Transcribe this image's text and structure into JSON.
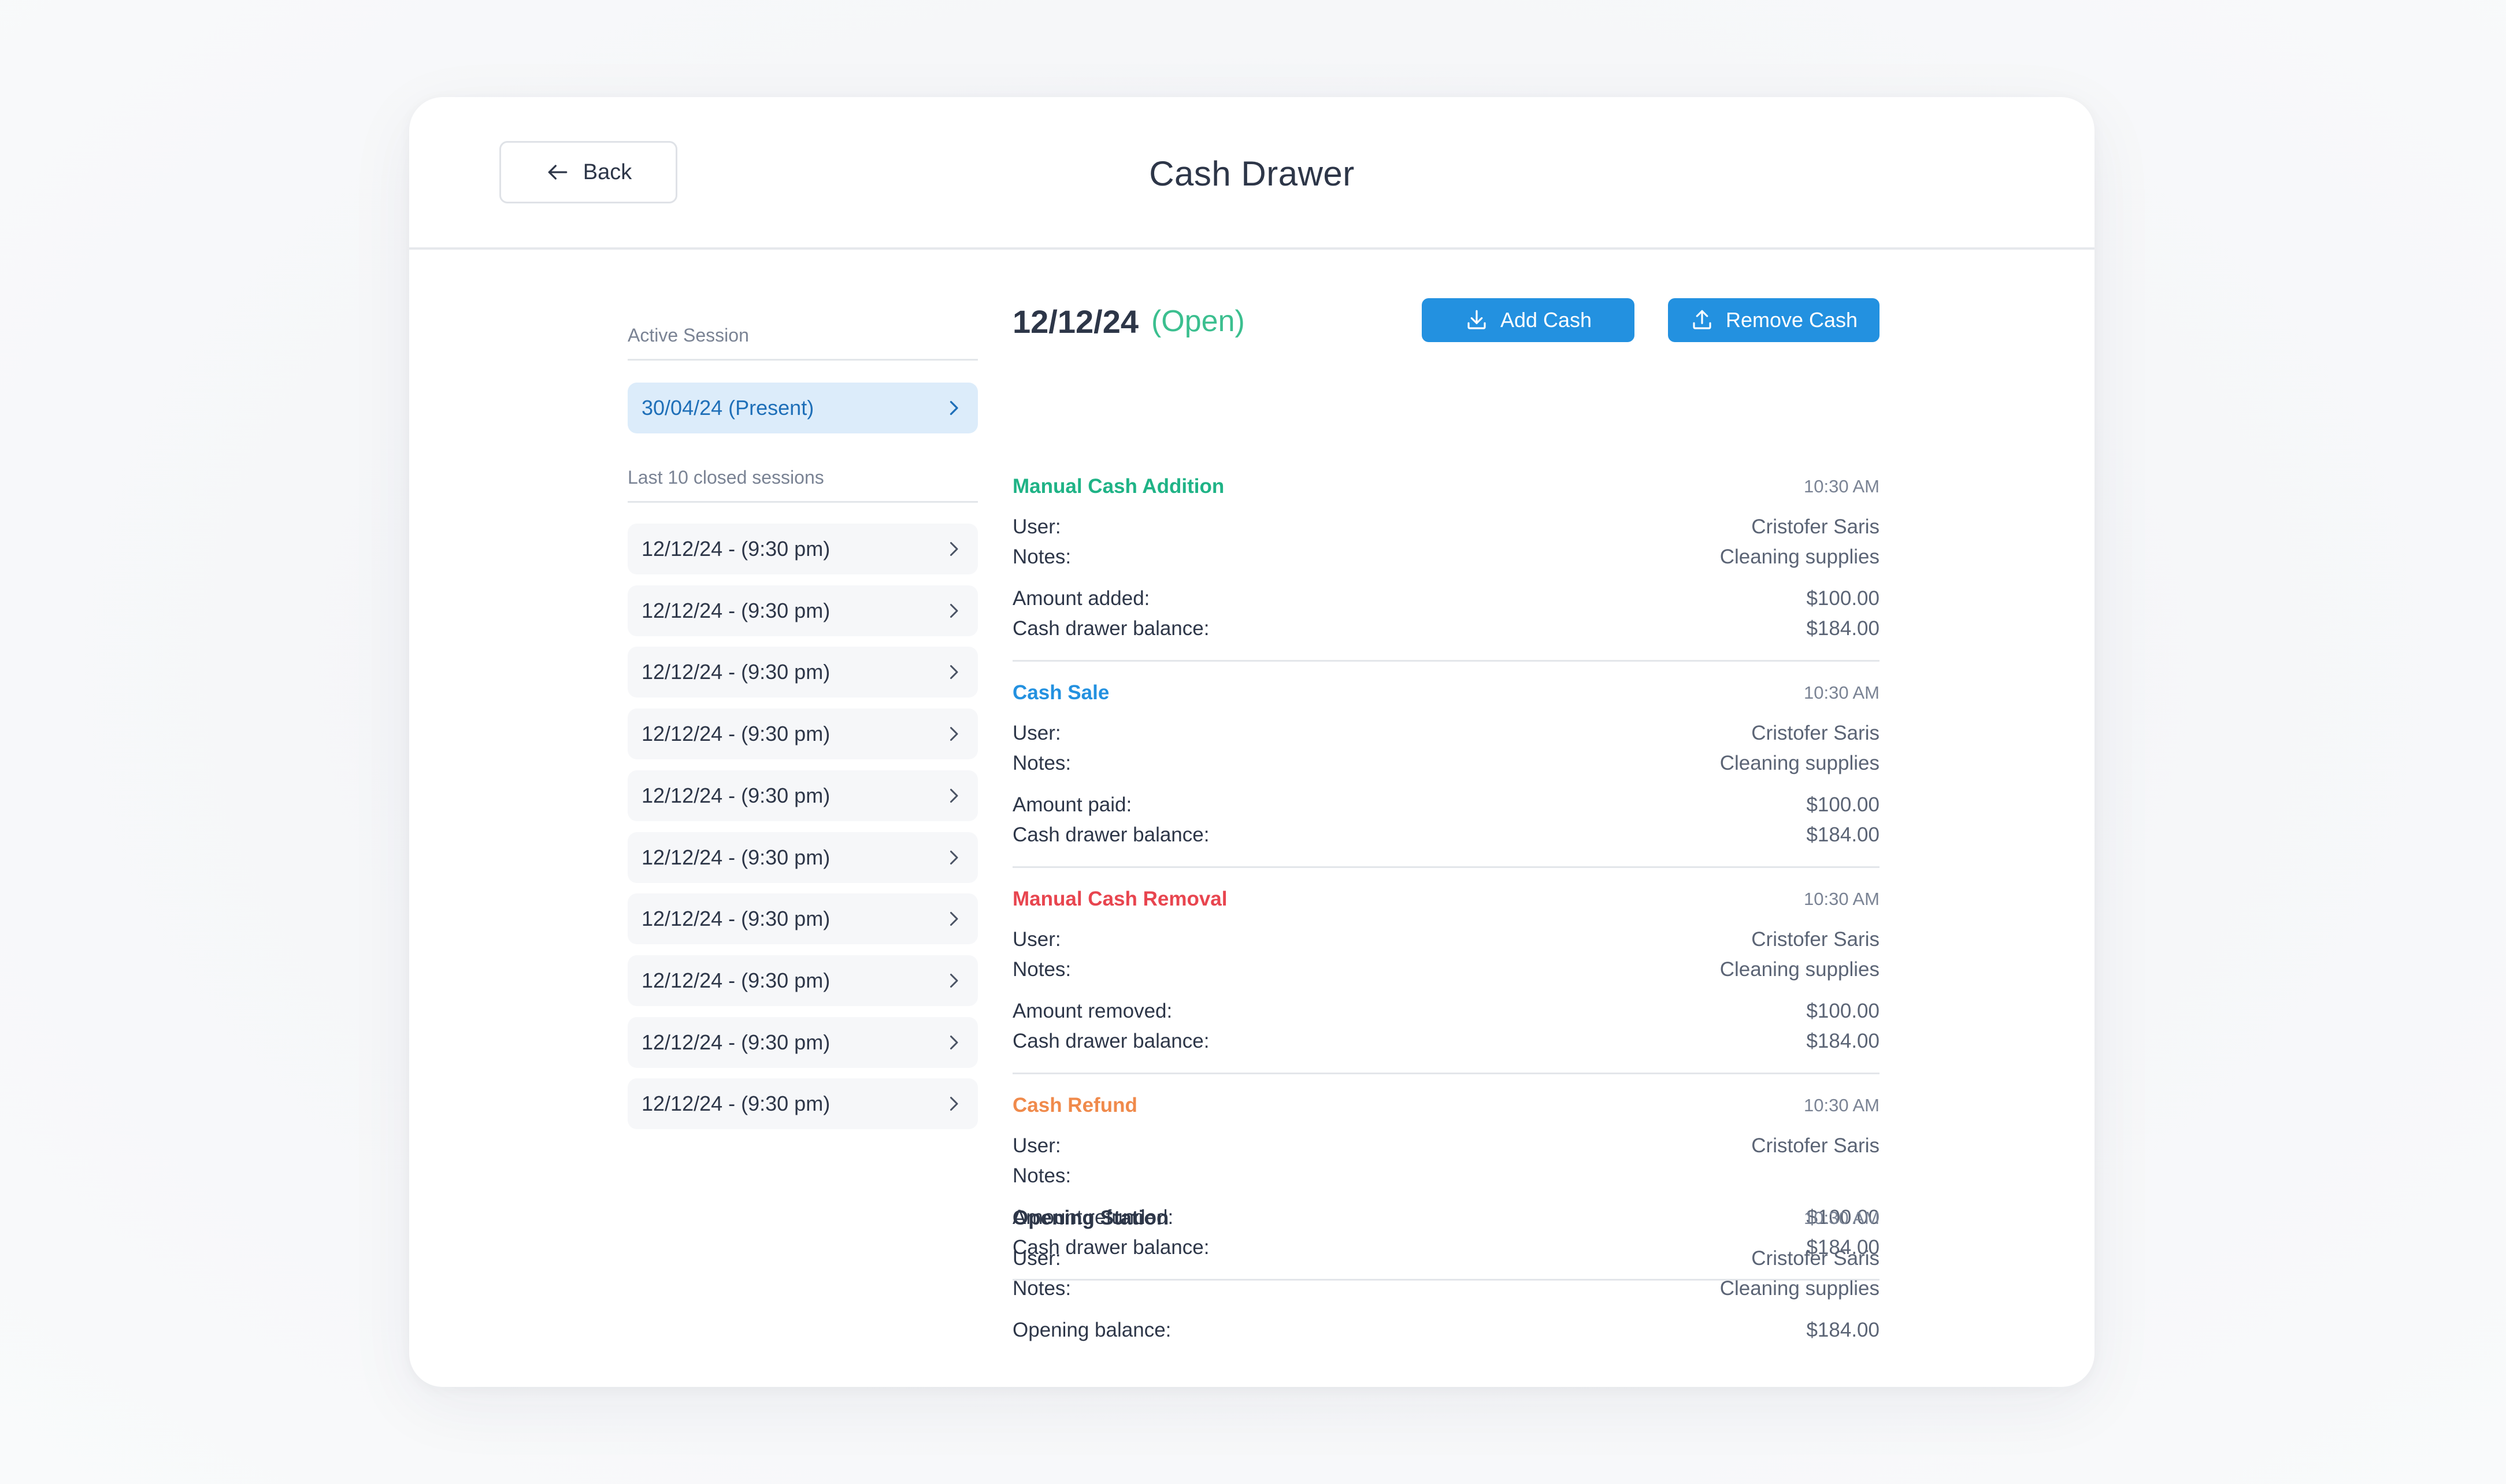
{
  "header": {
    "back_label": "Back",
    "title": "Cash Drawer"
  },
  "sidebar": {
    "active_label": "Active Session",
    "active_session": "30/04/24 (Present)",
    "closed_label": "Last 10 closed sessions",
    "closed_sessions": [
      "12/12/24 - (9:30 pm)",
      "12/12/24 - (9:30 pm)",
      "12/12/24 - (9:30 pm)",
      "12/12/24 - (9:30 pm)",
      "12/12/24 - (9:30 pm)",
      "12/12/24 - (9:30 pm)",
      "12/12/24 - (9:30 pm)",
      "12/12/24 - (9:30 pm)",
      "12/12/24 - (9:30 pm)",
      "12/12/24 - (9:30 pm)"
    ]
  },
  "main": {
    "session_date": "12/12/24",
    "session_status": "(Open)",
    "add_cash_label": "Add Cash",
    "remove_cash_label": "Remove Cash",
    "entries": [
      {
        "title": "Manual Cash Addition",
        "title_color": "#1fb386",
        "time": "10:30 AM",
        "user_label": "User:",
        "user": "Cristofer Saris",
        "notes_label": "Notes:",
        "notes": "Cleaning supplies",
        "amount_label": "Amount added:",
        "amount": "$100.00",
        "balance_label": "Cash drawer balance:",
        "balance": "$184.00"
      },
      {
        "title": "Cash Sale",
        "title_color": "#2391e0",
        "time": "10:30 AM",
        "user_label": "User:",
        "user": "Cristofer Saris",
        "notes_label": "Notes:",
        "notes": "Cleaning supplies",
        "amount_label": "Amount paid:",
        "amount": "$100.00",
        "balance_label": "Cash drawer balance:",
        "balance": "$184.00"
      },
      {
        "title": "Manual Cash Removal",
        "title_color": "#e8454f",
        "time": "10:30 AM",
        "user_label": "User:",
        "user": "Cristofer Saris",
        "notes_label": "Notes:",
        "notes": "Cleaning supplies",
        "amount_label": "Amount removed:",
        "amount": "$100.00",
        "balance_label": "Cash drawer balance:",
        "balance": "$184.00"
      },
      {
        "title": "Cash Refund",
        "title_color": "#f08a4b",
        "time": "10:30 AM",
        "user_label": "User:",
        "user": "Cristofer Saris",
        "notes_label": "Notes:",
        "notes": "",
        "amount_label": "Amount refunded:",
        "amount": "$100.00",
        "balance_label": "Cash drawer balance:",
        "balance": "$184.00"
      }
    ],
    "opening": {
      "title": "Opening Station",
      "title_color": "#2d3648",
      "time": "10:30 AM",
      "user_label": "User:",
      "user": "Cristofer Saris",
      "notes_label": "Notes:",
      "notes": "Cleaning supplies",
      "balance_label": "Opening balance:",
      "balance": "$184.00"
    }
  }
}
